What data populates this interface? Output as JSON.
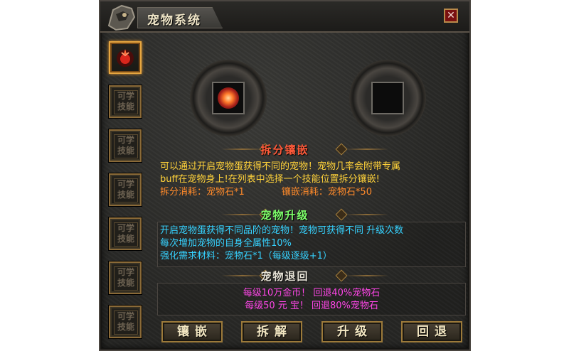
{
  "window": {
    "title": "宠物系统",
    "close_label": "✕"
  },
  "sidebar": {
    "selected_icon": "red-pet-icon",
    "slots": [
      {
        "text": ""
      },
      {
        "text": "可学技能"
      },
      {
        "text": "可学技能"
      },
      {
        "text": "可学技能"
      },
      {
        "text": "可学技能"
      },
      {
        "text": "可学技能"
      },
      {
        "text": "可学技能"
      }
    ]
  },
  "split_section": {
    "title": "拆分镶嵌",
    "desc_line1": "可以通过开启宠物蛋获得不同的宠物！宠物几率会附带专属",
    "desc_line2": "buff在宠物身上!在列表中选择一个技能位置拆分镶嵌!",
    "split_cost": "拆分消耗：宠物石*1",
    "inlay_cost": "镶嵌消耗：宠物石*50"
  },
  "upgrade_section": {
    "title": "宠物升级",
    "line1": "开启宠物蛋获得不同品阶的宠物！宠物可获得不同 升级次数",
    "line2": "每次增加宠物的自身全属性10%",
    "line3": "强化需求材料：宠物石*1（每级逐级+1）"
  },
  "retreat_section": {
    "title": "宠物退回",
    "line1": "每级10万金币！ 回退40%宠物石",
    "line2": "每级50 元 宝！ 回退80%宠物石"
  },
  "buttons": {
    "inlay": "镶嵌",
    "split": "拆解",
    "upgrade": "升级",
    "retreat": "回退"
  },
  "colors": {
    "yellow_text": "#ffd23a",
    "orange_text": "#ff8a2a",
    "cyan_text": "#36d2ff",
    "magenta_text": "#ff46e8"
  }
}
